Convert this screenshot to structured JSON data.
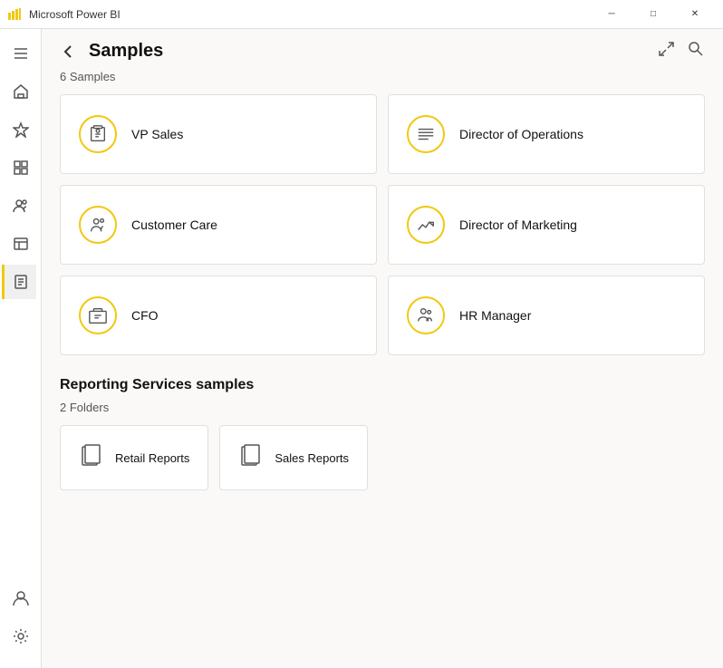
{
  "titlebar": {
    "title": "Microsoft Power BI",
    "minimize": "─",
    "maximize": "□",
    "close": "✕"
  },
  "header": {
    "title": "Samples",
    "count": "6 Samples"
  },
  "samples": [
    {
      "id": "vp-sales",
      "label": "VP Sales",
      "icon": "briefcase"
    },
    {
      "id": "director-ops",
      "label": "Director of Operations",
      "icon": "list"
    },
    {
      "id": "customer-care",
      "label": "Customer Care",
      "icon": "people"
    },
    {
      "id": "director-marketing",
      "label": "Director of Marketing",
      "icon": "chart"
    },
    {
      "id": "cfo",
      "label": "CFO",
      "icon": "case"
    },
    {
      "id": "hr-manager",
      "label": "HR Manager",
      "icon": "hr"
    }
  ],
  "reporting": {
    "title": "Reporting Services samples",
    "count": "2 Folders",
    "folders": [
      {
        "id": "retail-reports",
        "label": "Retail Reports"
      },
      {
        "id": "sales-reports",
        "label": "Sales Reports"
      }
    ]
  },
  "sidebar": {
    "items": [
      {
        "id": "hamburger",
        "icon": "menu",
        "label": "Menu"
      },
      {
        "id": "home",
        "icon": "home",
        "label": "Home"
      },
      {
        "id": "favorites",
        "icon": "star",
        "label": "Favorites"
      },
      {
        "id": "apps",
        "icon": "grid",
        "label": "Apps"
      },
      {
        "id": "shared",
        "icon": "people",
        "label": "Shared with me"
      },
      {
        "id": "workspace",
        "icon": "workspace",
        "label": "Workspace"
      },
      {
        "id": "reports",
        "icon": "reports",
        "label": "Reports",
        "active": true
      }
    ],
    "bottom": [
      {
        "id": "user",
        "icon": "user",
        "label": "User"
      },
      {
        "id": "settings",
        "icon": "settings",
        "label": "Settings"
      }
    ]
  }
}
